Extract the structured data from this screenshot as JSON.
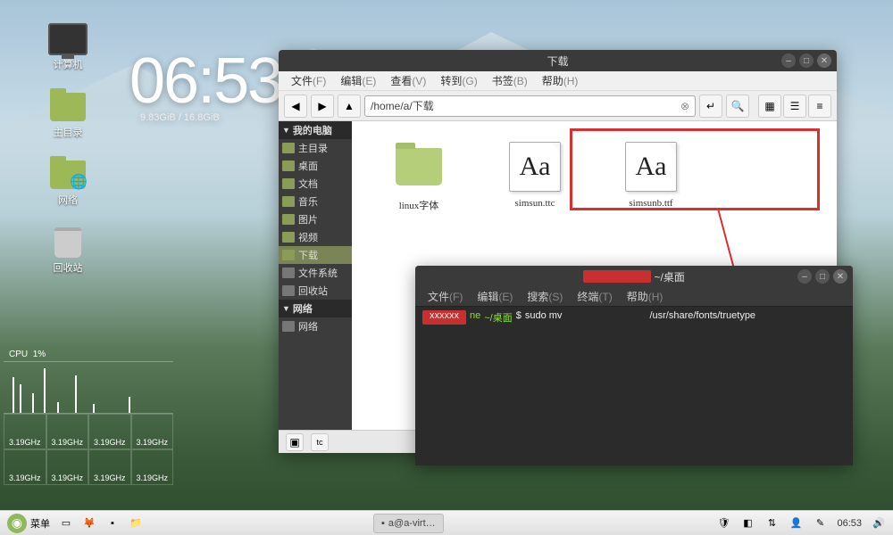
{
  "desktop": {
    "icons": [
      {
        "label": "计算机"
      },
      {
        "label": "主目录"
      },
      {
        "label": "网络"
      },
      {
        "label": "回收站"
      }
    ]
  },
  "clock": {
    "time": "06:53",
    "disk": "9.83GiB / 16.8GiB"
  },
  "cpu": {
    "title": "CPU",
    "pct": "1%",
    "freq": "3.19GHz"
  },
  "fm": {
    "title": "下载",
    "menus": [
      {
        "label": "文件",
        "key": "(F)"
      },
      {
        "label": "编辑",
        "key": "(E)"
      },
      {
        "label": "查看",
        "key": "(V)"
      },
      {
        "label": "转到",
        "key": "(G)"
      },
      {
        "label": "书签",
        "key": "(B)"
      },
      {
        "label": "帮助",
        "key": "(H)"
      }
    ],
    "path": "/home/a/下载",
    "sidebar": {
      "section1": "我的电脑",
      "items1": [
        "主目录",
        "桌面",
        "文档",
        "音乐",
        "图片",
        "视频",
        "下载",
        "文件系统",
        "回收站"
      ],
      "section2": "网络",
      "items2": [
        "网络"
      ]
    },
    "files": [
      {
        "label": "linux字体",
        "type": "folder"
      },
      {
        "label": "simsun.ttc",
        "type": "font",
        "glyph": "Aa"
      },
      {
        "label": "simsunb.ttf",
        "type": "font",
        "glyph": "Aa"
      }
    ]
  },
  "term": {
    "title_suffix": "~/桌面",
    "menus": [
      {
        "label": "文件",
        "key": "(F)"
      },
      {
        "label": "编辑",
        "key": "(E)"
      },
      {
        "label": "搜索",
        "key": "(S)"
      },
      {
        "label": "终端",
        "key": "(T)"
      },
      {
        "label": "帮助",
        "key": "(H)"
      }
    ],
    "path_display": "~/桌面",
    "prompt_char": "$",
    "command_pre": "sudo mv",
    "command_post": "/usr/share/fonts/truetype"
  },
  "taskbar": {
    "menu": "菜单",
    "active_task": "a@a-virt…",
    "time": "06:53"
  }
}
